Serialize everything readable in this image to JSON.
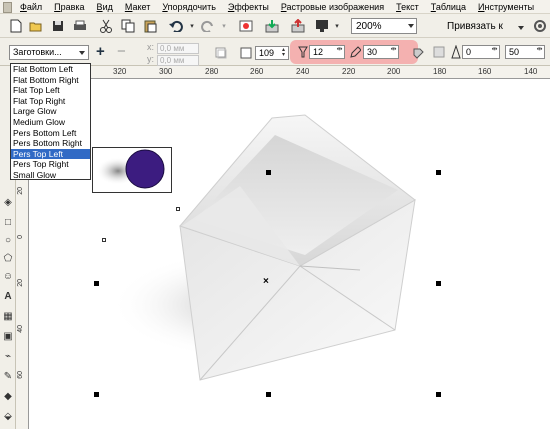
{
  "menu": [
    "Файл",
    "Правка",
    "Вид",
    "Макет",
    "Упорядочить",
    "Эффекты",
    "Растровые изображения",
    "Текст",
    "Таблица",
    "Инструменты"
  ],
  "toolbar": {
    "icons": [
      "new-icon",
      "open-icon",
      "save-icon",
      "cut-icon",
      "copy-icon",
      "paste-icon",
      "undo-icon",
      "redo-icon",
      "import-icon",
      "export-icon",
      "app-launcher-icon"
    ],
    "zoom": "200%",
    "snap_label": "Привязать к"
  },
  "propertybar": {
    "preset": "Заготовки...",
    "x_label": "x:",
    "y_label": "y:",
    "x_value": "0,0 мм",
    "y_value": "0,0 мм",
    "opacity": "109",
    "feather": "12",
    "feather_dir": "30",
    "color_value": "0",
    "shadow_value": "50"
  },
  "ruler": {
    "h_labels": [
      "320",
      "300",
      "280",
      "260",
      "240",
      "220",
      "200",
      "180",
      "160",
      "140"
    ],
    "v_labels": [
      "20",
      "0",
      "20",
      "40",
      "60"
    ]
  },
  "presets_list": {
    "items": [
      "Flat Bottom Left",
      "Flat Bottom Right",
      "Flat Top Left",
      "Flat Top Right",
      "Large Glow",
      "Medium Glow",
      "Pers Bottom Left",
      "Pers Bottom Right",
      "Pers Top Left",
      "Pers Top Right",
      "Small Glow"
    ],
    "selected": "Pers Top Left"
  },
  "colors": {
    "circle": "#3c1c80",
    "highlight": "#f4a6a6",
    "selection": "#316ac5"
  }
}
